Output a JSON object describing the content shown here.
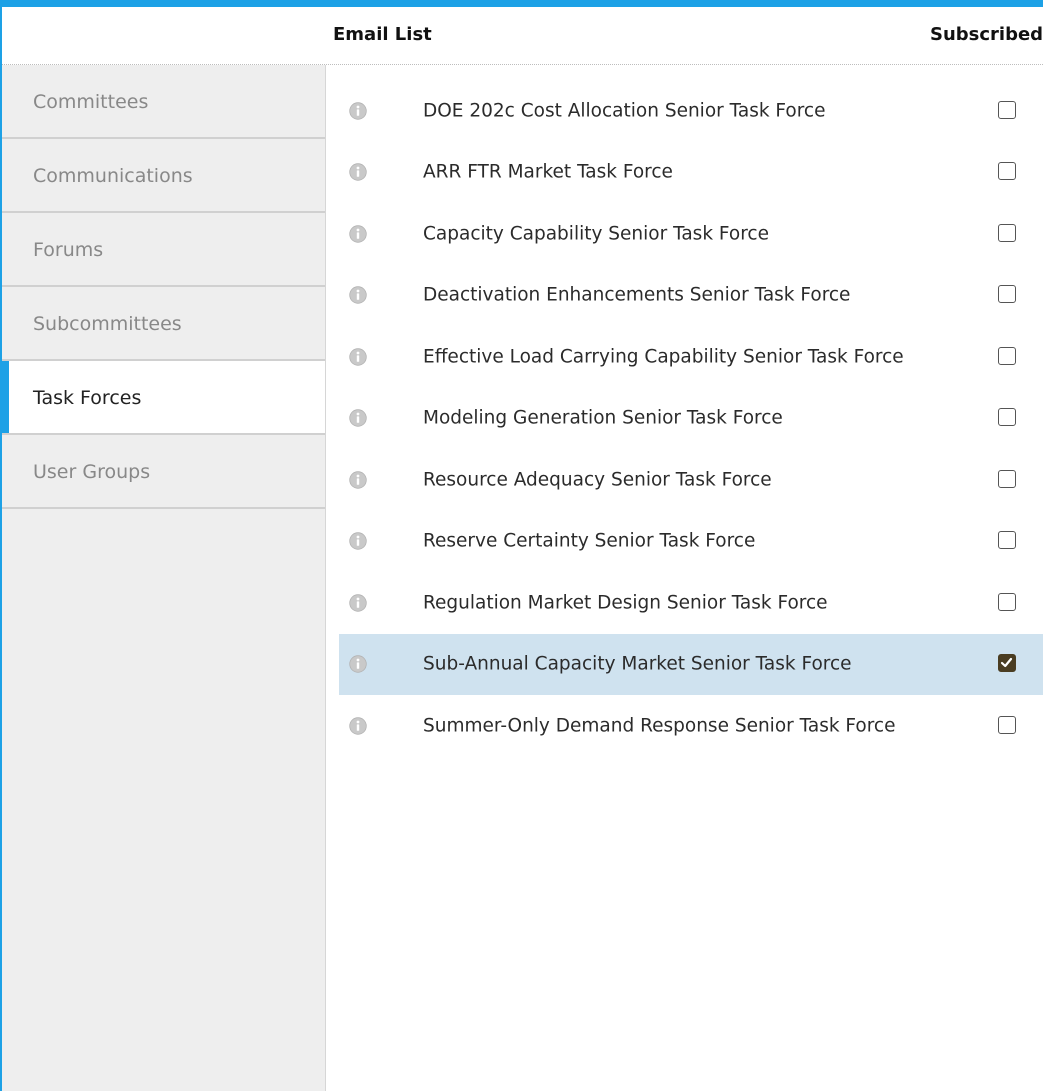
{
  "colors": {
    "accent": "#1da1e6",
    "checked_box": "#4a3d22",
    "selected_row": "#cfe2ef"
  },
  "header": {
    "email_list_label": "Email List",
    "subscribed_label": "Subscribed"
  },
  "sidebar": {
    "items": [
      {
        "label": "Committees",
        "active": false
      },
      {
        "label": "Communications",
        "active": false
      },
      {
        "label": "Forums",
        "active": false
      },
      {
        "label": "Subcommittees",
        "active": false
      },
      {
        "label": "Task Forces",
        "active": true
      },
      {
        "label": "User Groups",
        "active": false
      }
    ]
  },
  "email_lists": [
    {
      "name": "DOE 202c Cost Allocation Senior Task Force",
      "subscribed": false,
      "selected": false,
      "icon": "info-icon"
    },
    {
      "name": "ARR FTR Market Task Force",
      "subscribed": false,
      "selected": false,
      "icon": "info-icon"
    },
    {
      "name": "Capacity Capability Senior Task Force",
      "subscribed": false,
      "selected": false,
      "icon": "info-icon"
    },
    {
      "name": "Deactivation Enhancements Senior Task Force",
      "subscribed": false,
      "selected": false,
      "icon": "info-icon"
    },
    {
      "name": "Effective Load Carrying Capability Senior Task Force",
      "subscribed": false,
      "selected": false,
      "icon": "info-icon"
    },
    {
      "name": "Modeling Generation Senior Task Force",
      "subscribed": false,
      "selected": false,
      "icon": "info-icon"
    },
    {
      "name": "Resource Adequacy Senior Task Force",
      "subscribed": false,
      "selected": false,
      "icon": "info-icon"
    },
    {
      "name": "Reserve Certainty Senior Task Force",
      "subscribed": false,
      "selected": false,
      "icon": "info-icon"
    },
    {
      "name": "Regulation Market Design Senior Task Force",
      "subscribed": false,
      "selected": false,
      "icon": "info-icon"
    },
    {
      "name": "Sub-Annual Capacity Market Senior Task Force",
      "subscribed": true,
      "selected": true,
      "icon": "info-icon"
    },
    {
      "name": "Summer-Only Demand Response Senior Task Force",
      "subscribed": false,
      "selected": false,
      "icon": "info-icon"
    }
  ]
}
